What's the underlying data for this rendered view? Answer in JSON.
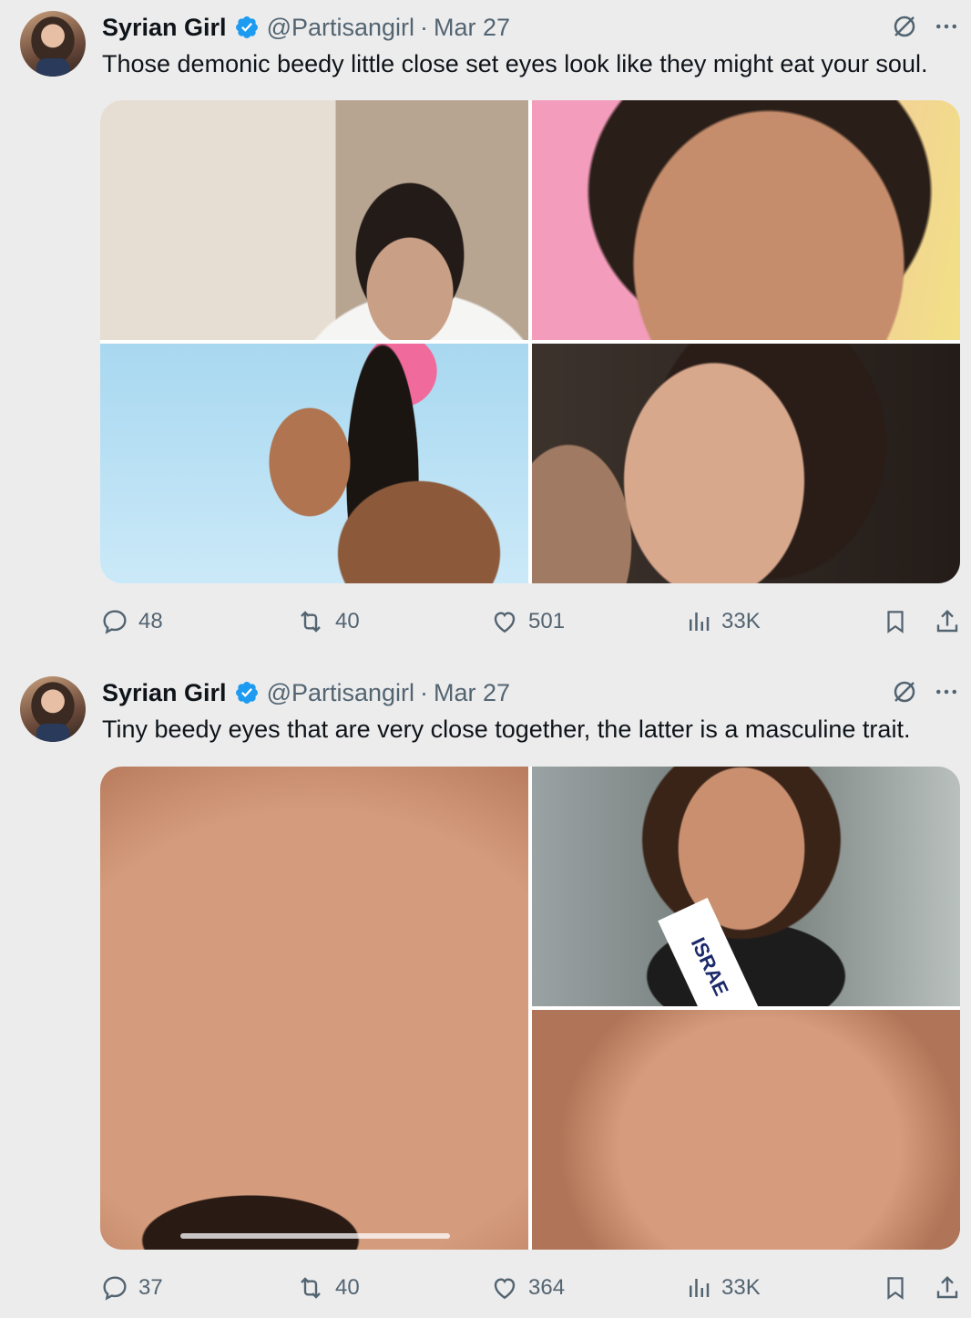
{
  "tweets": [
    {
      "author": {
        "name": "Syrian Girl",
        "handle": "@Partisangirl",
        "date": "Mar 27"
      },
      "dot": "·",
      "text": "Those demonic beedy little close set eyes look like they might eat your soul.",
      "media_count": 4,
      "stats": {
        "replies": "48",
        "reposts": "40",
        "likes": "501",
        "views": "33K"
      }
    },
    {
      "author": {
        "name": "Syrian Girl",
        "handle": "@Partisangirl",
        "date": "Mar 27"
      },
      "dot": "·",
      "text": "Tiny beedy eyes that are very close together, the latter is a masculine trait.",
      "media_count": 3,
      "sash_text": "ISRAE",
      "stats": {
        "replies": "37",
        "reposts": "40",
        "likes": "364",
        "views": "33K"
      }
    }
  ],
  "colors": {
    "verified": "#1d9bf0",
    "muted": "#536471",
    "text": "#0f1419",
    "background": "#ececed"
  },
  "icons": [
    "verified-badge-icon",
    "grok-icon",
    "more-icon",
    "reply-icon",
    "repost-icon",
    "like-icon",
    "views-icon",
    "bookmark-icon",
    "share-icon"
  ]
}
